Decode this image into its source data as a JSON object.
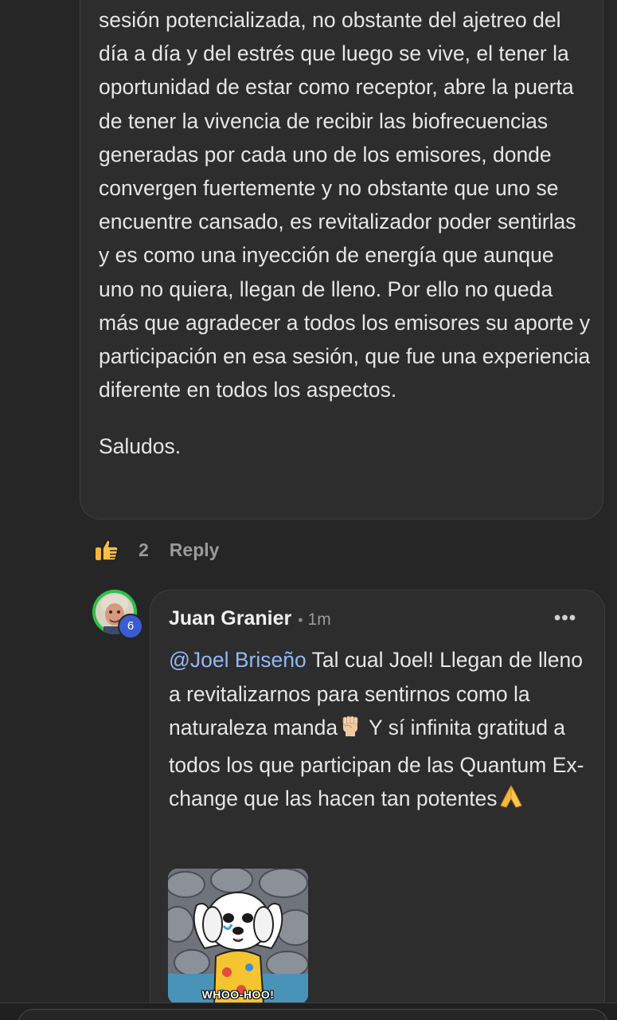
{
  "comment": {
    "paragraphs": [
      "sesión potencializada, no obstante del ajetreo del día a día y del estrés que luego se vive, el tener la oportunidad de estar como receptor, abre la puerta de tener la vivencia de recibir las biofrecuencias generadas por cada uno de los emisores, donde convergen fuertemente y no obstante que uno se encuentre cansado, es revitalizador poder sentirlas y es como una inyección de energía que aunque uno no quiera, llegan de lleno. Por ello no queda más que agradecer a todos los emisores su aporte y participación en esa sesión, que fue una experiencia diferente en todos los aspectos.",
      "Saludos."
    ],
    "likes": "2",
    "reply_label": "Reply",
    "like_icon": "thumbs-up-icon"
  },
  "reply": {
    "author": "Juan Granier",
    "separator": "•",
    "time": "1m",
    "more_icon": "•••",
    "badge": "6",
    "mention": "@Joel Briseño",
    "text_part1": " Tal cual Joel! Llegan de lleno a revitalizarnos para sentirnos como la naturaleza manda",
    "emoji1": "raised-fist-emoji",
    "text_part2": " Y sí infinita gratitud a todos los que participan de las Quantum Ex-change que las hacen tan potentes",
    "emoji2": "folded-hands-emoji",
    "gif_caption": "WHOO-HOO!"
  },
  "colors": {
    "background": "#262626",
    "bubble": "#2d2d2d",
    "mention": "#94b6f5",
    "badge": "#3d5bd0"
  }
}
